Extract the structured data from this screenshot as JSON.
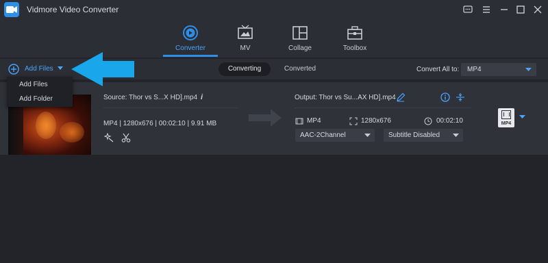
{
  "app": {
    "title": "Vidmore Video Converter",
    "logo_icon": "video-camera-icon",
    "accent": "#2f8fe8"
  },
  "window_controls": [
    "feedback-icon",
    "menu-icon",
    "minimize-icon",
    "maximize-icon",
    "close-icon"
  ],
  "nav": {
    "tabs": [
      {
        "label": "Converter",
        "icon": "converter-icon",
        "active": true
      },
      {
        "label": "MV",
        "icon": "mv-icon",
        "active": false
      },
      {
        "label": "Collage",
        "icon": "collage-icon",
        "active": false
      },
      {
        "label": "Toolbox",
        "icon": "toolbox-icon",
        "active": false
      }
    ]
  },
  "toolbar": {
    "add_files_label": "Add Files",
    "segments": [
      "Converting",
      "Converted"
    ],
    "convert_all_label": "Convert All to:",
    "convert_all_value": "MP4"
  },
  "dropdown": {
    "items": [
      "Add Files",
      "Add Folder"
    ]
  },
  "file": {
    "source_name": "Source: Thor vs S...X HD].mp4",
    "source_meta": "MP4 | 1280x676 | 00:02:10 | 9.91 MB",
    "output_name": "Output: Thor vs Su...AX HD].mp4",
    "output_format": "MP4",
    "output_resolution": "1280x676",
    "output_duration": "00:02:10",
    "audio_track": "AAC-2Channel",
    "subtitle": "Subtitle Disabled",
    "format_badge": "MP4"
  }
}
